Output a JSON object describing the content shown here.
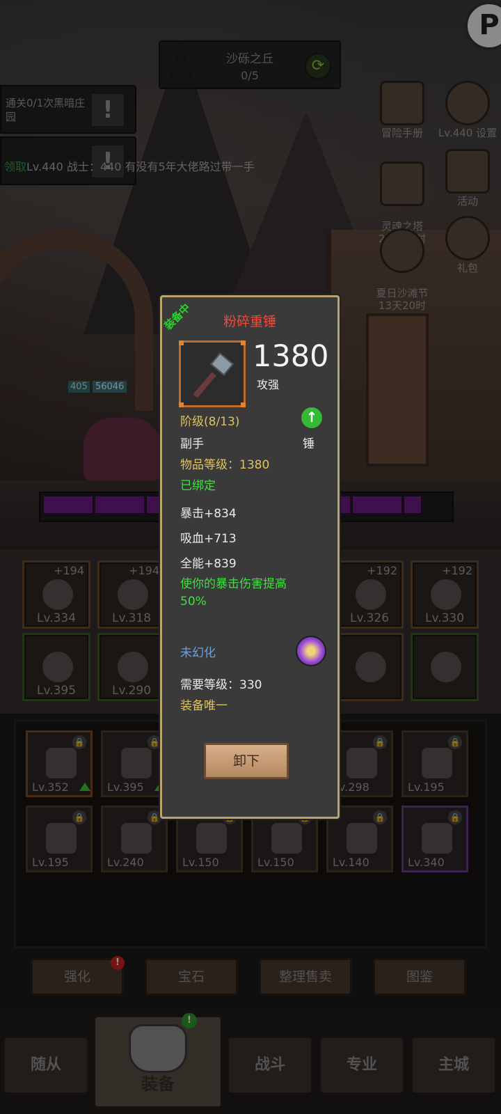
{
  "stage": {
    "name": "沙砾之丘",
    "progress": "0/5"
  },
  "quests": [
    {
      "text": "通关0/1次黑暗庄园"
    }
  ],
  "chat": {
    "claim": "领取",
    "message": "Lv.440 战士：440 有没有5年大佬路过带一手"
  },
  "right_menu": [
    {
      "label": "冒险手册",
      "icon": "book-icon"
    },
    {
      "label": "Lv.440 设置",
      "icon": "gear-icon"
    },
    {
      "label": "灵魂之塔\n20天20时",
      "icon": "tower-icon"
    },
    {
      "label": "活动",
      "icon": "scroll-icon"
    },
    {
      "label": "夏日沙滩节\n13天20时",
      "icon": "hat-icon"
    },
    {
      "label": "礼包",
      "icon": "gift-icon"
    }
  ],
  "hero": {
    "level": "405",
    "hp": "56046"
  },
  "equip_slots": [
    {
      "plus": "+194",
      "lv": "Lv.334"
    },
    {
      "plus": "+194",
      "lv": "Lv.318"
    },
    {
      "plus": "+192",
      "lv": "Lv.326"
    },
    {
      "plus": "+192",
      "lv": "Lv.330"
    },
    {
      "plus": "",
      "lv": "Lv.395"
    },
    {
      "plus": "",
      "lv": "Lv.290"
    },
    {
      "plus": "",
      "lv": ""
    },
    {
      "plus": "",
      "lv": ""
    }
  ],
  "bag_slots": [
    {
      "lv": "Lv.352"
    },
    {
      "lv": "Lv.395"
    },
    {
      "lv": "Lv.298"
    },
    {
      "lv": "Lv.195"
    },
    {
      "lv": "Lv.195"
    },
    {
      "lv": "Lv.240"
    },
    {
      "lv": "Lv.150"
    },
    {
      "lv": "Lv.150"
    },
    {
      "lv": "Lv.140"
    },
    {
      "lv": "Lv.340"
    }
  ],
  "actions": [
    "强化",
    "宝石",
    "整理售卖",
    "图鉴"
  ],
  "nav": [
    "随从",
    "装备",
    "战斗",
    "专业",
    "主城"
  ],
  "popup": {
    "equipped_tag": "装备中",
    "title": "粉碎重锤",
    "power": "1380",
    "power_label": "攻强",
    "tier": "阶级(8/13)",
    "slot": "副手",
    "type": "锤",
    "item_level": "物品等级：1380",
    "bound": "已绑定",
    "stats": [
      "暴击+834",
      "吸血+713",
      "全能+839"
    ],
    "effect": "使你的暴击伤害提高50%",
    "transmog": "未幻化",
    "required_level": "需要等级：330",
    "unique": "装备唯一",
    "unequip_button": "卸下"
  },
  "colors": {
    "title_red": "#f04a3a",
    "gold": "#e0c35a",
    "green": "#3fe03f",
    "blue": "#6ca0e0",
    "border_gold": "#b7a46f"
  }
}
